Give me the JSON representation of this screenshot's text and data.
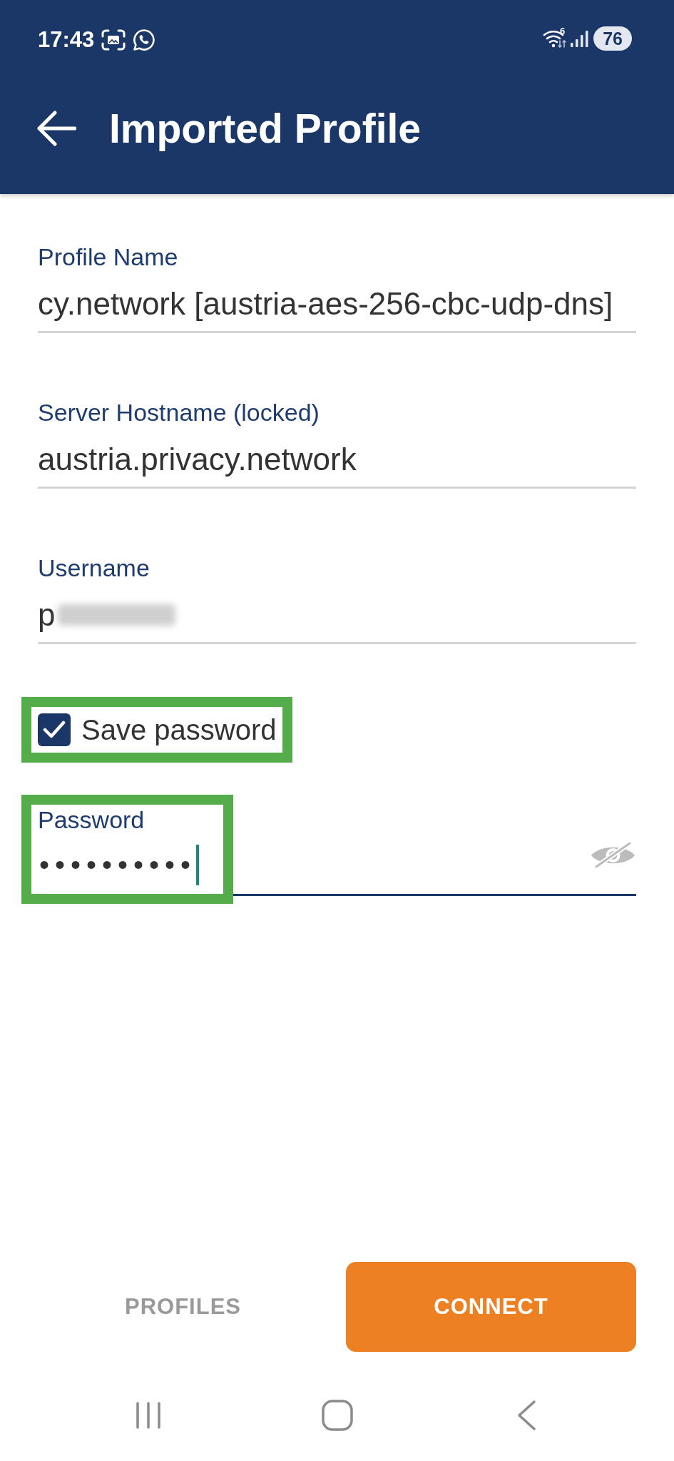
{
  "status_bar": {
    "time": "17:43",
    "wifi_label": "6",
    "battery": "76"
  },
  "toolbar": {
    "title": "Imported Profile"
  },
  "form": [
    {
      "kind": "text",
      "label": "Profile Name",
      "value": "cy.network [austria-aes-256-cbc-udp-dns]",
      "focused": false,
      "redacted": false
    },
    {
      "kind": "text",
      "label": "Server Hostname (locked)",
      "value": "austria.privacy.network",
      "focused": false,
      "redacted": false
    },
    {
      "kind": "text",
      "label": "Username",
      "value": "p",
      "focused": false,
      "redacted": true
    },
    {
      "kind": "checkbox",
      "label": "Save password",
      "checked": true,
      "highlighted": true
    },
    {
      "kind": "password",
      "label": "Password",
      "value": "••••••••••",
      "focused": true,
      "highlighted": true
    }
  ],
  "buttons": [
    {
      "kind": "text",
      "label": "PROFILES"
    },
    {
      "kind": "filled",
      "label": "CONNECT"
    }
  ]
}
